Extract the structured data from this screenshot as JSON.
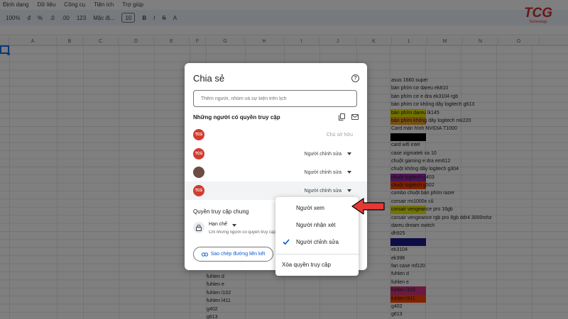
{
  "sheet": {
    "menu": [
      "Định dạng",
      "Dữ liệu",
      "Công cụ",
      "Tiện ích",
      "Trợ giúp"
    ],
    "toolbar": {
      "zoom": "100%",
      "currency": "đ",
      "percent": "%",
      "decimal_down": ".0",
      "decimal_up": ".00",
      "format_123": "123",
      "font": "Mặc đị...",
      "font_size": "10",
      "bold": "B",
      "italic": "I",
      "strike": "S",
      "text_color": "A"
    },
    "columns": [
      "A",
      "B",
      "C",
      "D",
      "E",
      "F",
      "G",
      "H",
      "I",
      "J",
      "K",
      "L",
      "M",
      "N",
      "O"
    ],
    "column_k_cells": [
      {
        "text": "asus 1660 super",
        "bg": ""
      },
      {
        "text": "bàn phím cơ dareu ek810",
        "bg": ""
      },
      {
        "text": "bàn phím cơ e dra ek3104 rgb",
        "bg": ""
      },
      {
        "text": "bàn phím cơ không dây logitech g613",
        "bg": ""
      },
      {
        "text": "bàn phím dareu lk145",
        "bg": "#e6e600"
      },
      {
        "text": "bàn phím không dây logitech mk220",
        "bg": "#f0a020"
      },
      {
        "text": "Card màn hình NVIDIA T1000",
        "bg": ""
      },
      {
        "text": "",
        "bg": "#000000"
      },
      {
        "text": "card wifi intel",
        "bg": ""
      },
      {
        "text": "case xigmatek xa 10",
        "bg": ""
      },
      {
        "text": "chuột gaming e dra em612",
        "bg": ""
      },
      {
        "text": "chuột không dây logitech g304",
        "bg": ""
      },
      {
        "text": "chuột logitech g403",
        "bg": "#9c27b0"
      },
      {
        "text": "chuột logitech g502",
        "bg": "#ff4500"
      },
      {
        "text": "combo chuột bàn phím razer",
        "bg": ""
      },
      {
        "text": "corsair rm1000x cũ",
        "bg": ""
      },
      {
        "text": "corsair vengeance pro 16gb",
        "bg": "#e6e600"
      },
      {
        "text": "corsair vengeance rgb pro 8gb ddr4 3000mhz",
        "bg": ""
      },
      {
        "text": "dareu dream switch",
        "bg": ""
      },
      {
        "text": "dh925",
        "bg": ""
      },
      {
        "text": "",
        "bg": "#1a1a8c"
      },
      {
        "text": "ek3104",
        "bg": ""
      },
      {
        "text": "ek398",
        "bg": ""
      },
      {
        "text": "fan case mf120",
        "bg": ""
      },
      {
        "text": "fuhlen d",
        "bg": ""
      },
      {
        "text": "fuhlen e",
        "bg": ""
      },
      {
        "text": "fuhlen l102",
        "bg": "#d63384"
      },
      {
        "text": "fuhlen l411",
        "bg": "#ff4500"
      },
      {
        "text": "g402",
        "bg": ""
      },
      {
        "text": "g613",
        "bg": ""
      }
    ],
    "column_g_cells": [
      "fuhlen d",
      "fuhlen e",
      "fuhlen l102",
      "fuhlen l411",
      "g402",
      "g613"
    ]
  },
  "logo": {
    "text": "TCG",
    "subtext": "Technology"
  },
  "dialog": {
    "title": "Chia sẻ",
    "help": "?",
    "add_placeholder": "Thêm người, nhóm và sự kiện trên lịch",
    "access_heading": "Những người có quyền truy cập",
    "people": [
      {
        "avatar": "TCG",
        "role": "Chủ sở hữu",
        "has_caret": false
      },
      {
        "avatar": "TCG",
        "role": "Người chỉnh sửa",
        "has_caret": true
      },
      {
        "avatar": "",
        "role": "Người chỉnh sửa",
        "has_caret": true
      },
      {
        "avatar": "TCG",
        "role": "Người chỉnh sửa",
        "has_caret": true
      }
    ],
    "general_access_heading": "Quyền truy cập chung",
    "restriction": "Hạn chế",
    "restriction_desc": "Chỉ những người có quyền truy cập",
    "copy_link": "Sao chép đường liên kết"
  },
  "role_menu": {
    "items": [
      "Người xem",
      "Người nhận xét",
      "Người chỉnh sửa"
    ],
    "selected": "Người chỉnh sửa",
    "remove": "Xóa quyền truy cập"
  },
  "colors": {
    "accent": "#0b57d0",
    "arrow": "#e53935",
    "avatar_brand": "#d33c2f"
  }
}
